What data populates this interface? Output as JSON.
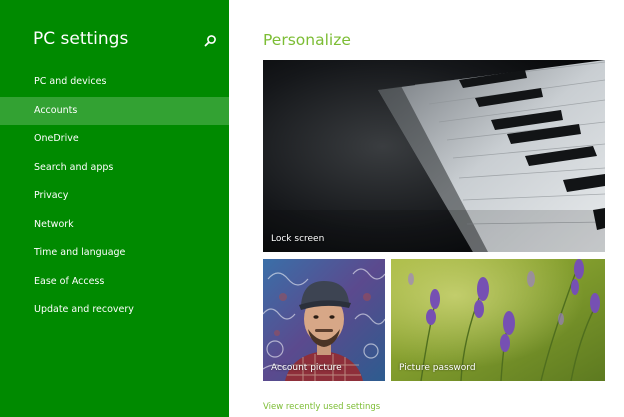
{
  "sidebar": {
    "title": "PC settings",
    "search_icon": "search-icon",
    "selected_index": 1,
    "items": [
      {
        "label": "PC and devices"
      },
      {
        "label": "Accounts"
      },
      {
        "label": "OneDrive"
      },
      {
        "label": "Search and apps"
      },
      {
        "label": "Privacy"
      },
      {
        "label": "Network"
      },
      {
        "label": "Time and language"
      },
      {
        "label": "Ease of Access"
      },
      {
        "label": "Update and recovery"
      }
    ]
  },
  "main": {
    "title": "Personalize",
    "tiles": {
      "lock_screen": {
        "label": "Lock screen"
      },
      "account_picture": {
        "label": "Account picture"
      },
      "picture_password": {
        "label": "Picture password"
      }
    },
    "footer_link": "View recently used settings"
  },
  "colors": {
    "sidebar_bg": "#008a00",
    "selected_bg": "#33a233",
    "accent": "#7cbd34",
    "content_bg": "#ffffff"
  }
}
